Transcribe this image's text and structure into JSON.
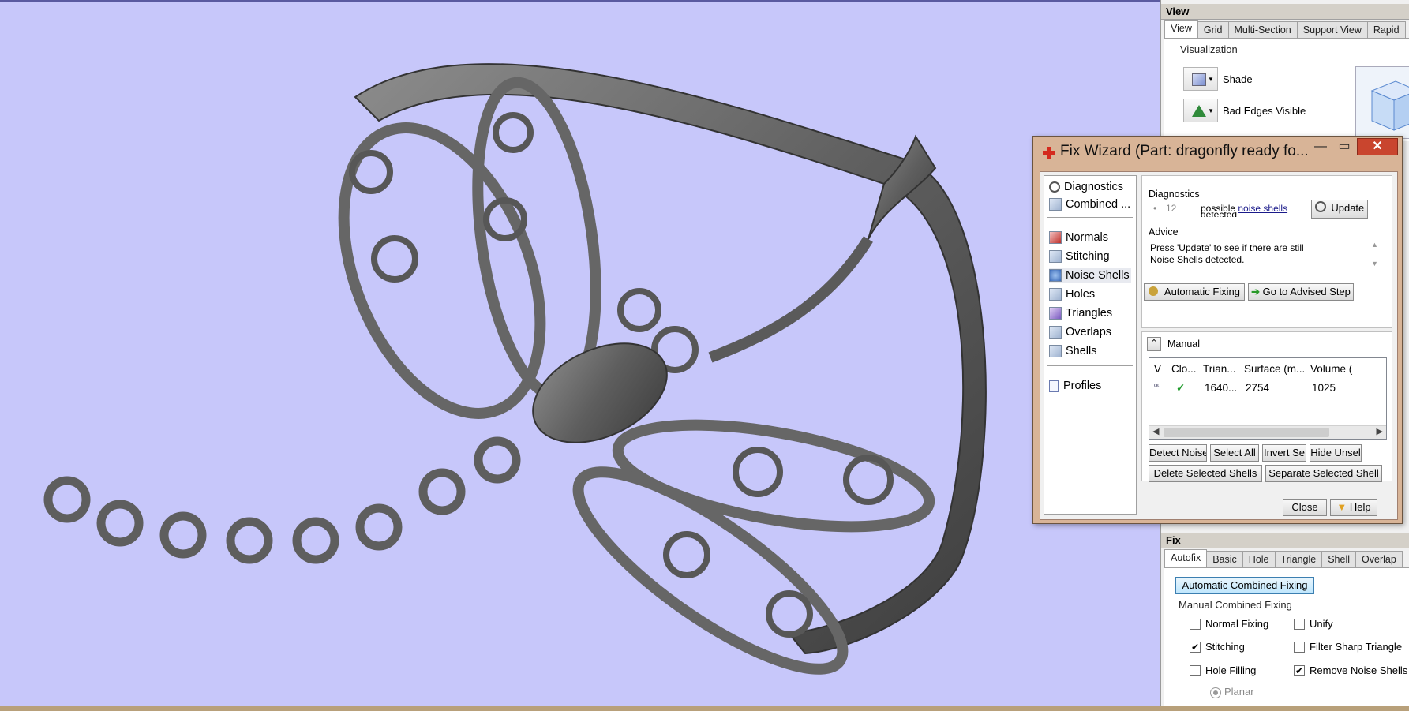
{
  "view_panel": {
    "title": "View",
    "tabs": [
      "View",
      "Grid",
      "Multi-Section",
      "Support View",
      "Rapid"
    ],
    "group": "Visualization",
    "rows": [
      "Shade",
      "Bad Edges Visible"
    ]
  },
  "fix_wizard": {
    "title": "Fix Wizard (Part: dragonfly ready fo...",
    "controls": {
      "minimize": "—",
      "maximize": "▭",
      "close": "✕"
    },
    "nav_top": [
      "Diagnostics",
      "Combined ..."
    ],
    "nav_steps": [
      "Normals",
      "Stitching",
      "Noise Shells",
      "Holes",
      "Triangles",
      "Overlaps",
      "Shells"
    ],
    "nav_bottom": [
      "Profiles"
    ],
    "diagnostics": {
      "label": "Diagnostics",
      "bullet": "•",
      "count": "12",
      "text_prefix": "possible",
      "link": "noise shells",
      "text_suffix": "detected",
      "update_button": "Update"
    },
    "advice": {
      "label": "Advice",
      "text": "Press 'Update' to see if there are still Noise Shells detected."
    },
    "automatic_fixing": "Automatic Fixing",
    "go_to_advised": "Go to Advised Step",
    "manual": {
      "label": "Manual",
      "columns": [
        "V",
        "Clo...",
        "Trian...",
        "Surface (m...",
        "Volume ("
      ],
      "rows": [
        {
          "closed": "✓",
          "triangles": "1640...",
          "surface": "2754",
          "volume": "1025"
        }
      ]
    },
    "buttons_row1": [
      "Detect Noise",
      "Select All",
      "Invert Se",
      "Hide Unsel"
    ],
    "buttons_row2": [
      "Delete Selected Shells",
      "Separate Selected Shell"
    ],
    "close": "Close",
    "help": "Help"
  },
  "fix_panel": {
    "title": "Fix",
    "tabs": [
      "Autofix",
      "Basic",
      "Hole",
      "Triangle",
      "Shell",
      "Overlap"
    ],
    "auto_button": "Automatic Combined Fixing",
    "manual_label": "Manual Combined Fixing",
    "options": [
      {
        "label": "Normal Fixing",
        "checked": false
      },
      {
        "label": "Unify",
        "checked": false
      },
      {
        "label": "Stitching",
        "checked": true
      },
      {
        "label": "Filter Sharp Triangle",
        "checked": false
      },
      {
        "label": "Hole Filling",
        "checked": false
      },
      {
        "label": "Remove Noise Shells",
        "checked": true
      }
    ],
    "radio_label": "Planar"
  },
  "colors": {
    "viewport_bg": "#c7c7fa",
    "model": "#6b6b6b",
    "wizard_frame": "#d8b497",
    "close_red": "#c9452e"
  }
}
